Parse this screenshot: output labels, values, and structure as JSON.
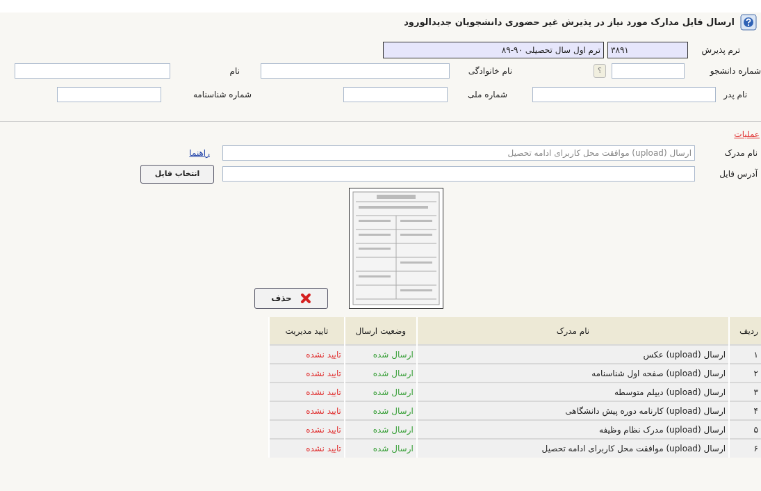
{
  "title": "ارسال فایل مدارک مورد نیاز در پذیرش غیر حضوری دانشجویان جدیدالورود",
  "term_row": {
    "label": "ترم پذیرش",
    "code": "۳۸۹۱",
    "name": "ترم اول سال تحصیلی ۹۰-۸۹"
  },
  "student_fields": [
    {
      "label": "شماره دانشجو"
    },
    {
      "label": "نام خانوادگی"
    },
    {
      "label": "نام"
    },
    {
      "label": "نام پدر"
    },
    {
      "label": "شماره ملی"
    },
    {
      "label": "شماره شناسنامه"
    }
  ],
  "help_button": {
    "label": "؟"
  },
  "operations": {
    "heading": "عملیات",
    "document_label": "نام مدرک",
    "document_value": "ارسال (upload) موافقت محل کاربرای ادامه تحصیل",
    "guide_link": "راهنما",
    "file_label": "آدرس فایل",
    "choose_button": "انتخاب فایل",
    "delete_button": "حذف"
  },
  "table": {
    "columns": [
      "ردیف",
      "نام مدرک",
      "وضعیت ارسال",
      "تایید مدیریت"
    ],
    "rows": [
      {
        "index": "۱",
        "name": "ارسال (upload) عکس",
        "status": "ارسال شده",
        "sent": true,
        "approval": "تایید نشده",
        "approved": false
      },
      {
        "index": "۲",
        "name": "ارسال (upload)  صفحه اول شناسنامه",
        "status": "ارسال شده",
        "sent": true,
        "approval": "تایید نشده",
        "approved": false
      },
      {
        "index": "۳",
        "name": "ارسال (upload) دیپلم متوسطه",
        "status": "ارسال شده",
        "sent": true,
        "approval": "تایید نشده",
        "approved": false
      },
      {
        "index": "۴",
        "name": "ارسال (upload) کارنامه دوره پیش دانشگاهی",
        "status": "ارسال شده",
        "sent": true,
        "approval": "تایید نشده",
        "approved": false
      },
      {
        "index": "۵",
        "name": "ارسال (upload) مدرک نظام وظیفه",
        "status": "ارسال شده",
        "sent": true,
        "approval": "تایید نشده",
        "approved": false
      },
      {
        "index": "۶",
        "name": "ارسال (upload) موافقت محل کاربرای ادامه تحصیل",
        "status": "ارسال شده",
        "sent": true,
        "approval": "تایید نشده",
        "approved": false
      }
    ]
  }
}
